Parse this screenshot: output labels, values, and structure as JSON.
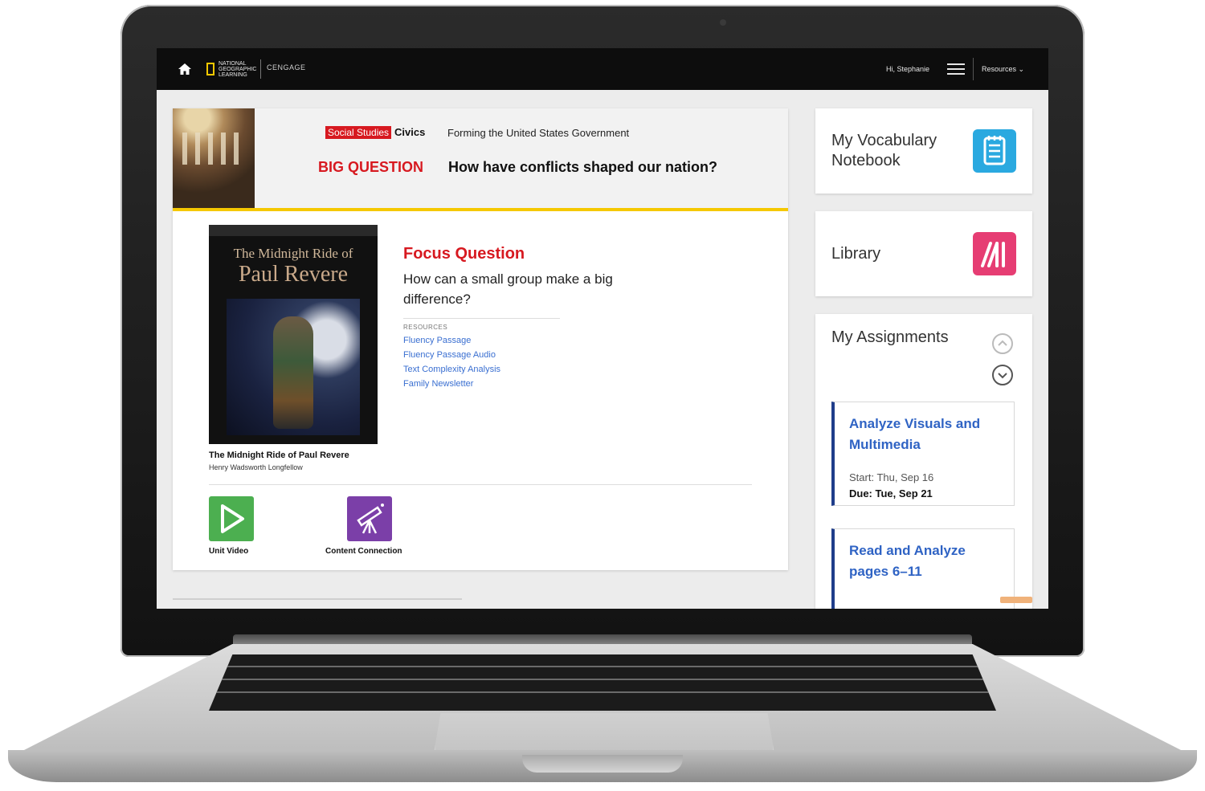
{
  "header": {
    "brand_primary": "NATIONAL GEOGRAPHIC LEARNING",
    "brand_secondary": "CENGAGE",
    "greeting": "Hi, Stephanie",
    "resources_label": "Resources ⌄"
  },
  "banner": {
    "subject_tag": "Social Studies",
    "subject": "Civics",
    "unit_title": "Forming the United States Government",
    "big_question_label": "BIG QUESTION",
    "big_question": "How have conflicts shaped our nation?"
  },
  "book": {
    "cover_line1": "The Midnight Ride of",
    "cover_line2": "Paul Revere",
    "title": "The Midnight Ride of Paul Revere",
    "author": "Henry Wadsworth Longfellow"
  },
  "focus": {
    "label": "Focus Question",
    "question": "How can a small group make a big difference?",
    "resources_label": "RESOURCES",
    "resources": [
      "Fluency Passage",
      "Fluency Passage Audio",
      "Text Complexity Analysis",
      "Family Newsletter"
    ]
  },
  "tools": [
    {
      "label": "Unit Video",
      "icon": "play-icon"
    },
    {
      "label": "Content Connection",
      "icon": "telescope-icon"
    }
  ],
  "sidebar": {
    "vocab_title": "My Vocabulary Notebook",
    "library_title": "Library",
    "assignments_title": "My Assignments",
    "assignments": [
      {
        "title": "Analyze Visuals and Multimedia",
        "start": "Start: Thu, Sep 16",
        "due": "Due: Tue, Sep 21"
      },
      {
        "title": "Read and Analyze pages 6–11",
        "start": "",
        "due": ""
      }
    ]
  },
  "colors": {
    "accent_red": "#d71920",
    "accent_yellow": "#f5c800",
    "link_blue": "#3a6fd1",
    "assignment_border": "#1f3d8a"
  }
}
